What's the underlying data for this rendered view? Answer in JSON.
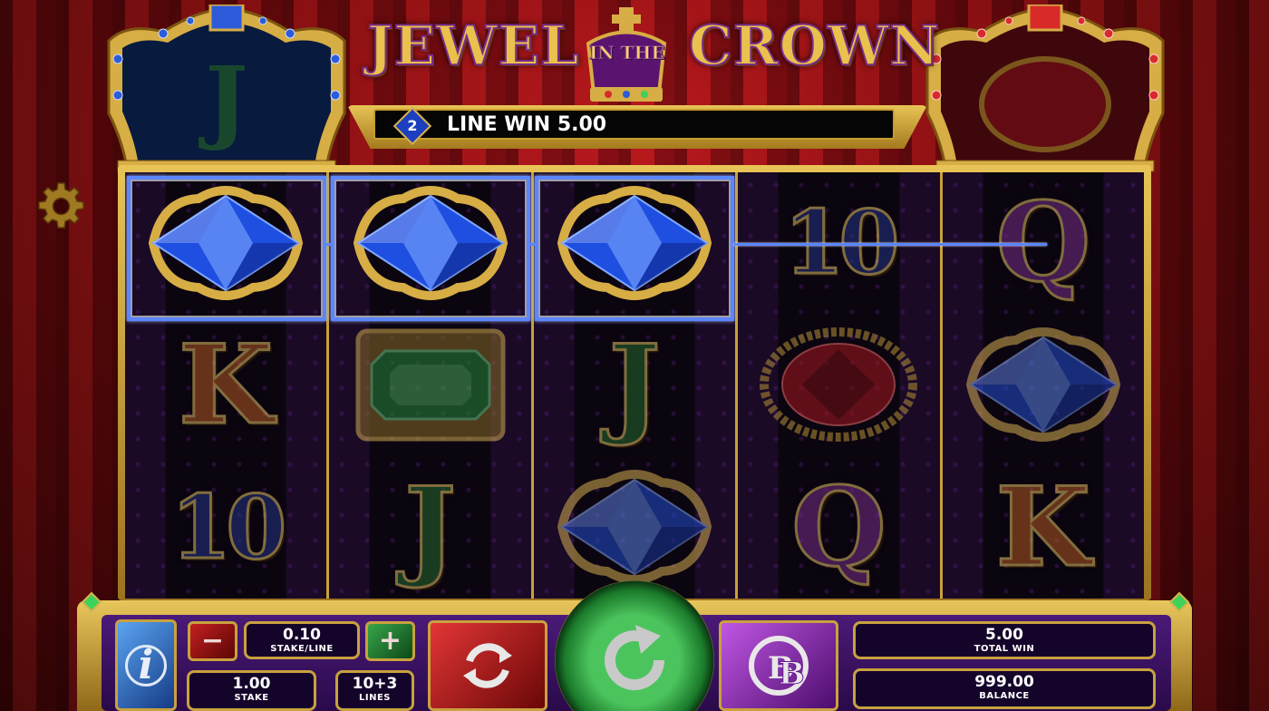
{
  "title": {
    "word1": "JEWEL",
    "word2": "IN THE",
    "word3": "CROWN"
  },
  "banner": {
    "line_number": "2",
    "text": "LINE WIN 5.00"
  },
  "reels": [
    {
      "symbols": [
        "Blue Gem",
        "K",
        "10"
      ]
    },
    {
      "symbols": [
        "Blue Gem",
        "Green Gem",
        "J"
      ]
    },
    {
      "symbols": [
        "Blue Gem",
        "J",
        "Blue Gem"
      ]
    },
    {
      "symbols": [
        "10",
        "Red Gem",
        "Q"
      ]
    },
    {
      "symbols": [
        "Q",
        "Blue Gem",
        "K"
      ]
    }
  ],
  "win": {
    "line": 2,
    "winning_cells": [
      [
        0,
        0
      ],
      [
        1,
        0
      ],
      [
        2,
        0
      ]
    ]
  },
  "controls": {
    "stake_per_line_value": "0.10",
    "stake_per_line_label": "STAKE/LINE",
    "stake_value": "1.00",
    "stake_label": "STAKE",
    "lines_value": "10+3",
    "lines_label": "LINES",
    "total_win_value": "5.00",
    "total_win_label": "TOTAL WIN",
    "balance_value": "999.00",
    "balance_label": "BALANCE",
    "minus_glyph": "−",
    "plus_glyph": "+",
    "info_glyph": "i"
  },
  "icons": {
    "settings": "gear-icon",
    "info": "info-icon",
    "autoplay": "autoplay-arrows-icon",
    "spin": "spin-arrow-icon",
    "bonus": "bb-bonus-icon"
  },
  "colors": {
    "win_line": "#5b86ff",
    "gold": "#d9b24d",
    "panel_purple": "#3a0f62",
    "curtain_red": "#9b0f14"
  }
}
